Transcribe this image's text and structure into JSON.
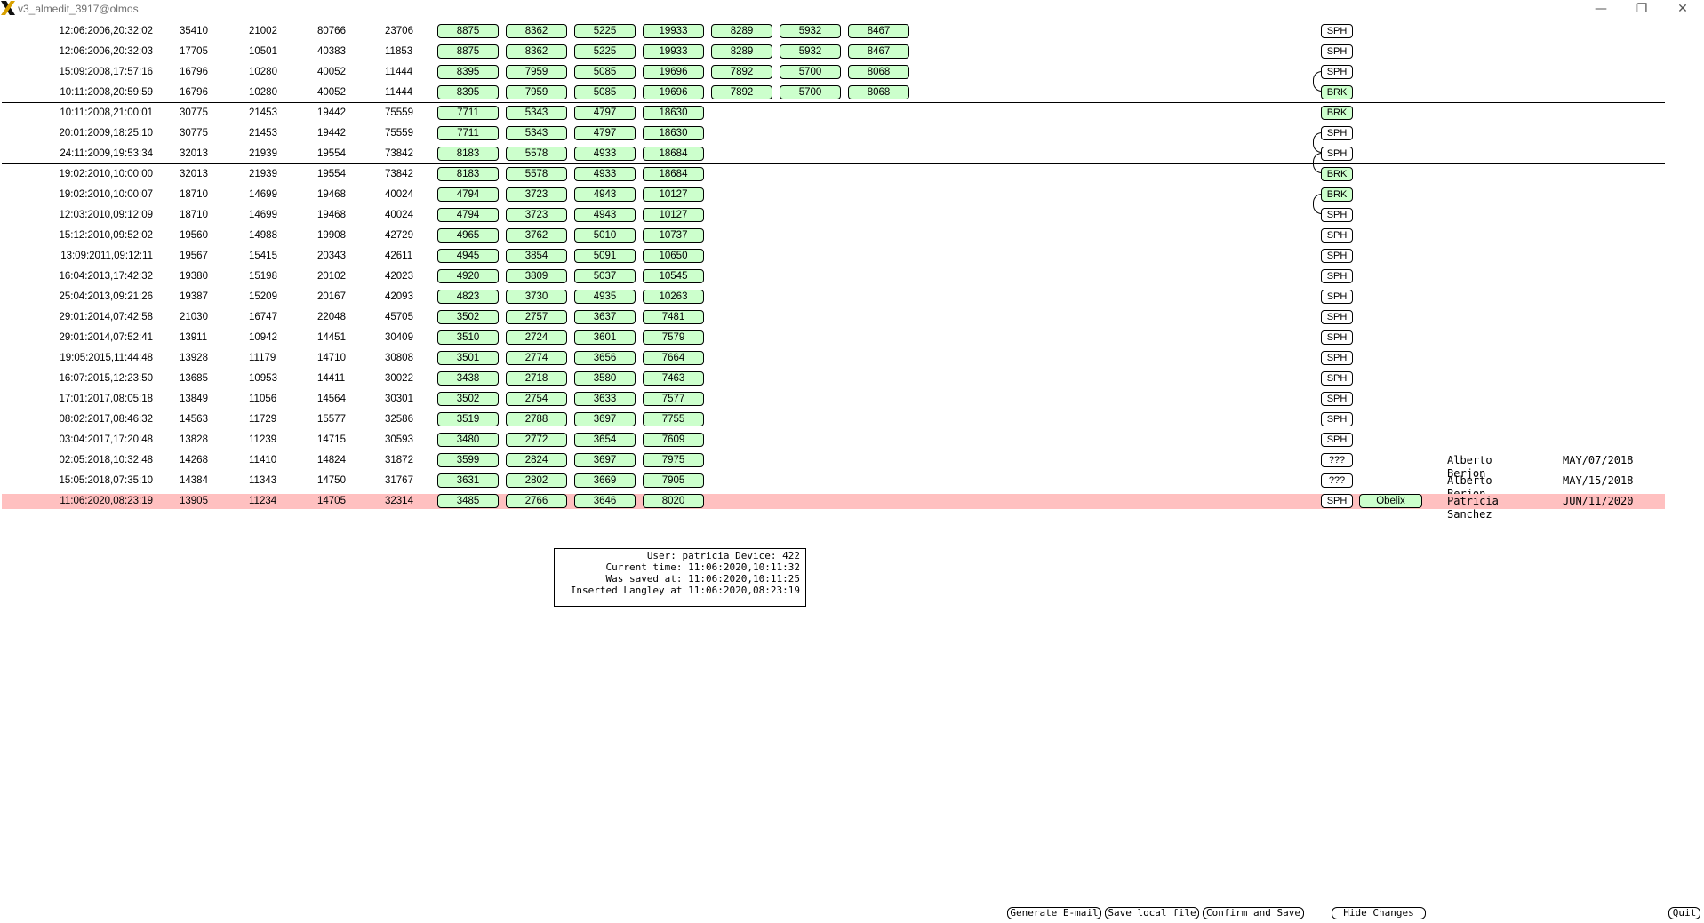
{
  "window": {
    "title": "v3_almedit_3917@olmos",
    "minimize": "—",
    "restore": "❐",
    "close": "✕"
  },
  "rows": [
    {
      "ts": "12:06:2006,20:32:02",
      "n": [
        "35410",
        "21002",
        "80766",
        "23706"
      ],
      "g": [
        "8875",
        "8362",
        "5225",
        "19933",
        "8289",
        "5932",
        "8467"
      ],
      "tag": "SPH",
      "device": "",
      "who": "",
      "when": "",
      "highlight": false
    },
    {
      "ts": "12:06:2006,20:32:03",
      "n": [
        "17705",
        "10501",
        "40383",
        "11853"
      ],
      "g": [
        "8875",
        "8362",
        "5225",
        "19933",
        "8289",
        "5932",
        "8467"
      ],
      "tag": "SPH",
      "device": "",
      "who": "",
      "when": "",
      "highlight": false
    },
    {
      "ts": "15:09:2008,17:57:16",
      "n": [
        "16796",
        "10280",
        "40052",
        "11444"
      ],
      "g": [
        "8395",
        "7959",
        "5085",
        "19696",
        "7892",
        "5700",
        "8068"
      ],
      "tag": "SPH",
      "device": "",
      "who": "",
      "when": "",
      "highlight": false
    },
    {
      "ts": "10:11:2008,20:59:59",
      "n": [
        "16796",
        "10280",
        "40052",
        "11444"
      ],
      "g": [
        "8395",
        "7959",
        "5085",
        "19696",
        "7892",
        "5700",
        "8068"
      ],
      "tag": "BRK",
      "device": "",
      "who": "",
      "when": "",
      "highlight": false
    },
    {
      "ts": "10:11:2008,21:00:01",
      "n": [
        "30775",
        "21453",
        "19442",
        "75559"
      ],
      "g": [
        "7711",
        "5343",
        "4797",
        "18630"
      ],
      "tag": "BRK",
      "device": "",
      "who": "",
      "when": "",
      "highlight": false
    },
    {
      "ts": "20:01:2009,18:25:10",
      "n": [
        "30775",
        "21453",
        "19442",
        "75559"
      ],
      "g": [
        "7711",
        "5343",
        "4797",
        "18630"
      ],
      "tag": "SPH",
      "device": "",
      "who": "",
      "when": "",
      "highlight": false
    },
    {
      "ts": "24:11:2009,19:53:34",
      "n": [
        "32013",
        "21939",
        "19554",
        "73842"
      ],
      "g": [
        "8183",
        "5578",
        "4933",
        "18684"
      ],
      "tag": "SPH",
      "device": "",
      "who": "",
      "when": "",
      "highlight": false
    },
    {
      "ts": "19:02:2010,10:00:00",
      "n": [
        "32013",
        "21939",
        "19554",
        "73842"
      ],
      "g": [
        "8183",
        "5578",
        "4933",
        "18684"
      ],
      "tag": "BRK",
      "device": "",
      "who": "",
      "when": "",
      "highlight": false
    },
    {
      "ts": "19:02:2010,10:00:07",
      "n": [
        "18710",
        "14699",
        "19468",
        "40024"
      ],
      "g": [
        "4794",
        "3723",
        "4943",
        "10127"
      ],
      "tag": "BRK",
      "device": "",
      "who": "",
      "when": "",
      "highlight": false
    },
    {
      "ts": "12:03:2010,09:12:09",
      "n": [
        "18710",
        "14699",
        "19468",
        "40024"
      ],
      "g": [
        "4794",
        "3723",
        "4943",
        "10127"
      ],
      "tag": "SPH",
      "device": "",
      "who": "",
      "when": "",
      "highlight": false
    },
    {
      "ts": "15:12:2010,09:52:02",
      "n": [
        "19560",
        "14988",
        "19908",
        "42729"
      ],
      "g": [
        "4965",
        "3762",
        "5010",
        "10737"
      ],
      "tag": "SPH",
      "device": "",
      "who": "",
      "when": "",
      "highlight": false
    },
    {
      "ts": "13:09:2011,09:12:11",
      "n": [
        "19567",
        "15415",
        "20343",
        "42611"
      ],
      "g": [
        "4945",
        "3854",
        "5091",
        "10650"
      ],
      "tag": "SPH",
      "device": "",
      "who": "",
      "when": "",
      "highlight": false
    },
    {
      "ts": "16:04:2013,17:42:32",
      "n": [
        "19380",
        "15198",
        "20102",
        "42023"
      ],
      "g": [
        "4920",
        "3809",
        "5037",
        "10545"
      ],
      "tag": "SPH",
      "device": "",
      "who": "",
      "when": "",
      "highlight": false
    },
    {
      "ts": "25:04:2013,09:21:26",
      "n": [
        "19387",
        "15209",
        "20167",
        "42093"
      ],
      "g": [
        "4823",
        "3730",
        "4935",
        "10263"
      ],
      "tag": "SPH",
      "device": "",
      "who": "",
      "when": "",
      "highlight": false
    },
    {
      "ts": "29:01:2014,07:42:58",
      "n": [
        "21030",
        "16747",
        "22048",
        "45705"
      ],
      "g": [
        "3502",
        "2757",
        "3637",
        "7481"
      ],
      "tag": "SPH",
      "device": "",
      "who": "",
      "when": "",
      "highlight": false
    },
    {
      "ts": "29:01:2014,07:52:41",
      "n": [
        "13911",
        "10942",
        "14451",
        "30409"
      ],
      "g": [
        "3510",
        "2724",
        "3601",
        "7579"
      ],
      "tag": "SPH",
      "device": "",
      "who": "",
      "when": "",
      "highlight": false
    },
    {
      "ts": "19:05:2015,11:44:48",
      "n": [
        "13928",
        "11179",
        "14710",
        "30808"
      ],
      "g": [
        "3501",
        "2774",
        "3656",
        "7664"
      ],
      "tag": "SPH",
      "device": "",
      "who": "",
      "when": "",
      "highlight": false
    },
    {
      "ts": "16:07:2015,12:23:50",
      "n": [
        "13685",
        "10953",
        "14411",
        "30022"
      ],
      "g": [
        "3438",
        "2718",
        "3580",
        "7463"
      ],
      "tag": "SPH",
      "device": "",
      "who": "",
      "when": "",
      "highlight": false
    },
    {
      "ts": "17:01:2017,08:05:18",
      "n": [
        "13849",
        "11056",
        "14564",
        "30301"
      ],
      "g": [
        "3502",
        "2754",
        "3633",
        "7577"
      ],
      "tag": "SPH",
      "device": "",
      "who": "",
      "when": "",
      "highlight": false
    },
    {
      "ts": "08:02:2017,08:46:32",
      "n": [
        "14563",
        "11729",
        "15577",
        "32586"
      ],
      "g": [
        "3519",
        "2788",
        "3697",
        "7755"
      ],
      "tag": "SPH",
      "device": "",
      "who": "",
      "when": "",
      "highlight": false
    },
    {
      "ts": "03:04:2017,17:20:48",
      "n": [
        "13828",
        "11239",
        "14715",
        "30593"
      ],
      "g": [
        "3480",
        "2772",
        "3654",
        "7609"
      ],
      "tag": "SPH",
      "device": "",
      "who": "",
      "when": "",
      "highlight": false
    },
    {
      "ts": "02:05:2018,10:32:48",
      "n": [
        "14268",
        "11410",
        "14824",
        "31872"
      ],
      "g": [
        "3599",
        "2824",
        "3697",
        "7975"
      ],
      "tag": "???",
      "device": "",
      "who": "Alberto Berjon",
      "when": "MAY/07/2018",
      "highlight": false
    },
    {
      "ts": "15:05:2018,07:35:10",
      "n": [
        "14384",
        "11343",
        "14750",
        "31767"
      ],
      "g": [
        "3631",
        "2802",
        "3669",
        "7905"
      ],
      "tag": "???",
      "device": "",
      "who": "Alberto Berjon",
      "when": "MAY/15/2018",
      "highlight": false
    },
    {
      "ts": "11:06:2020,08:23:19",
      "n": [
        "13905",
        "11234",
        "14705",
        "32314"
      ],
      "g": [
        "3485",
        "2766",
        "3646",
        "8020"
      ],
      "tag": "SPH",
      "device": "Obelix",
      "who": "Patricia Sanchez",
      "when": "JUN/11/2020",
      "highlight": true
    }
  ],
  "info": {
    "line1": "User: patricia Device: 422",
    "line2": "Current time: 11:06:2020,10:11:32",
    "line3": "Was saved at: 11:06:2020,10:11:25",
    "line4": "Inserted Langley at 11:06:2020,08:23:19"
  },
  "buttons": {
    "generate_email": "Generate E-mail",
    "save_local": "Save local file",
    "confirm_save": "Confirm and Save",
    "hide_changes": "Hide Changes",
    "quit": "Quit"
  },
  "colors": {
    "cell_green": "#ccffcc",
    "row_highlight": "#ffc0c0"
  }
}
